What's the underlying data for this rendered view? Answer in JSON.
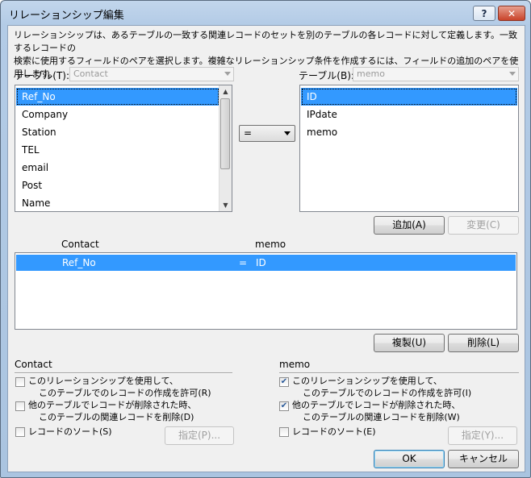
{
  "window": {
    "title": "リレーションシップ編集",
    "help_label": "?",
    "close_label": "✕"
  },
  "description": {
    "line1": "リレーションシップは、あるテーブルの一致する関連レコードのセットを別のテーブルの各レコードに対して定義します。一致するレコードの",
    "line2": "検索に使用するフィールドのペアを選択します。複雑なリレーションシップ条件を作成するには、フィールドの追加のペアを使用します。"
  },
  "left_table": {
    "label": "テーブル(T):",
    "value": "Contact",
    "fields": [
      "Ref_No",
      "Company",
      "Station",
      "TEL",
      "email",
      "Post",
      "Name"
    ],
    "selected_index": 0
  },
  "right_table": {
    "label": "テーブル(B):",
    "value": "memo",
    "fields": [
      "ID",
      "IPdate",
      "memo"
    ],
    "selected_index": 0
  },
  "operator": {
    "value": "="
  },
  "buttons": {
    "add": "追加(A)",
    "change": "変更(C)",
    "duplicate": "複製(U)",
    "delete": "削除(L)",
    "ok": "OK",
    "cancel": "キャンセル"
  },
  "pairs": {
    "left_header": "Contact",
    "right_header": "memo",
    "rows": [
      {
        "left": "Ref_No",
        "op": "=",
        "right": "ID"
      }
    ]
  },
  "left_options": {
    "heading": "Contact",
    "allow_create": {
      "line1": "このリレーションシップを使用して、",
      "line2": "このテーブルでのレコードの作成を許可(R)",
      "checked": false
    },
    "cascade_delete": {
      "line1": "他のテーブルでレコードが削除された時、",
      "line2": "このテーブルの関連レコードを削除(D)",
      "checked": false
    },
    "sort": {
      "label": "レコードのソート(S)",
      "checked": false
    },
    "specify": "指定(P)..."
  },
  "right_options": {
    "heading": "memo",
    "allow_create": {
      "line1": "このリレーションシップを使用して、",
      "line2": "このテーブルでのレコードの作成を許可(I)",
      "checked": true
    },
    "cascade_delete": {
      "line1": "他のテーブルでレコードが削除された時、",
      "line2": "このテーブルの関連レコードを削除(W)",
      "checked": true
    },
    "sort": {
      "label": "レコードのソート(E)",
      "checked": false
    },
    "specify": "指定(Y)..."
  },
  "colors": {
    "selection": "#3399ff",
    "title_bar": "#b3cbe6",
    "close_button": "#c9432a"
  }
}
